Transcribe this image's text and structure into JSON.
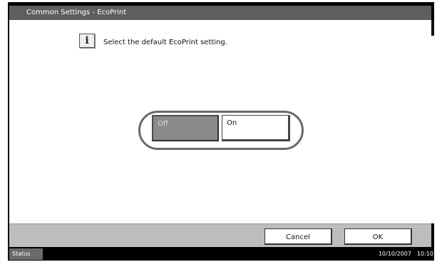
{
  "window": {
    "title": "Common Settings - EcoPrint"
  },
  "message": {
    "icon": "info-icon",
    "text": "Select the default EcoPrint setting."
  },
  "options": {
    "selected": "Off",
    "off_label": "Off",
    "on_label": "On"
  },
  "actions": {
    "cancel_label": "Cancel",
    "ok_label": "OK"
  },
  "status_bar": {
    "status_label": "Status",
    "date": "10/10/2007",
    "time": "10:10"
  },
  "colors": {
    "title_bar": "#5e5e5e",
    "selected_option": "#8a8a8a",
    "action_bar": "#bdbdbd",
    "status_bar": "#000000"
  }
}
